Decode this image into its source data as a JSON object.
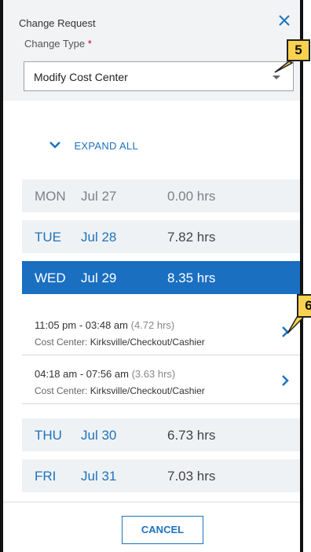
{
  "header": {
    "title": "Change Request",
    "close_glyph": "✕"
  },
  "change_type": {
    "label": "Change Type",
    "required_mark": "*",
    "value": "Modify Cost Center"
  },
  "callouts": {
    "first": "5",
    "second": "6"
  },
  "expand_all": "EXPAND ALL",
  "days": [
    {
      "dow": "MON",
      "date": "Jul 27",
      "hours": "0.00 hrs"
    },
    {
      "dow": "TUE",
      "date": "Jul 28",
      "hours": "7.82 hrs"
    },
    {
      "dow": "WED",
      "date": "Jul 29",
      "hours": "8.35 hrs"
    },
    {
      "dow": "THU",
      "date": "Jul 30",
      "hours": "6.73 hrs"
    },
    {
      "dow": "FRI",
      "date": "Jul 31",
      "hours": "7.03 hrs"
    }
  ],
  "entries": [
    {
      "time": "11:05 pm - 03:48 am",
      "duration": "(4.72 hrs)",
      "cc_label": "Cost Center:",
      "cc_value": "Kirksville/Checkout/Cashier"
    },
    {
      "time": "04:18 am - 07:56 am",
      "duration": "(3.63 hrs)",
      "cc_label": "Cost Center:",
      "cc_value": "Kirksville/Checkout/Cashier"
    }
  ],
  "footer": {
    "cancel_label": "CANCEL"
  },
  "colors": {
    "accent": "#1e73be",
    "active_day": "#1a6fc1",
    "callout": "#fbd24f"
  }
}
